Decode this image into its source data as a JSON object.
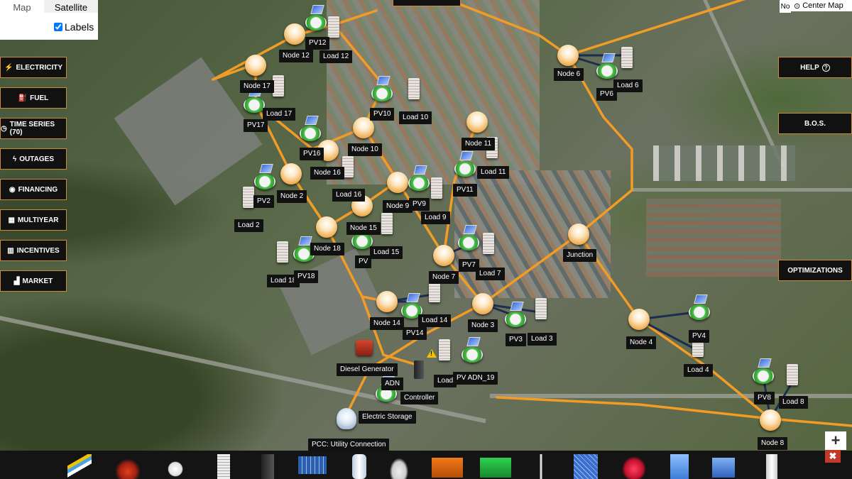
{
  "map_toggle": {
    "map_label": "Map",
    "satellite_label": "Satellite",
    "labels_label": "Labels",
    "labels_checked": true
  },
  "top_right": {
    "center_map_label": "Center Map",
    "no_label": "No"
  },
  "left_menu": [
    {
      "key": "electricity",
      "label": "ELECTRICITY",
      "icon": "bolt-icon",
      "glyph": "⚡"
    },
    {
      "key": "fuel",
      "label": "FUEL",
      "icon": "fuel-pump-icon",
      "glyph": "⛽"
    },
    {
      "key": "time-series",
      "label": "TIME SERIES (70)",
      "icon": "clock-icon",
      "glyph": "◷"
    },
    {
      "key": "outages",
      "label": "OUTAGES",
      "icon": "bolt-outline-icon",
      "glyph": "ϟ"
    },
    {
      "key": "financing",
      "label": "FINANCING",
      "icon": "globe-icon",
      "glyph": "◉"
    },
    {
      "key": "multiyear",
      "label": "MULTIYEAR",
      "icon": "calendar-icon",
      "glyph": "▦"
    },
    {
      "key": "incentives",
      "label": "INCENTIVES",
      "icon": "bar-chart-icon",
      "glyph": "▥"
    },
    {
      "key": "market",
      "label": "MARKET",
      "icon": "market-chart-icon",
      "glyph": "▟"
    }
  ],
  "right_menu": [
    {
      "key": "help",
      "label": "HELP",
      "icon": "question-circle-icon",
      "glyph": "?"
    },
    {
      "key": "bos",
      "label": "B.O.S.",
      "icon": "",
      "glyph": ""
    },
    {
      "key": "optimizations",
      "label": "OPTIMIZATIONS",
      "icon": "",
      "glyph": ""
    }
  ],
  "map_labels": [
    "Node 12",
    "Load 12",
    "PV12",
    "Node 6",
    "Load 6",
    "PV6",
    "Node 17",
    "Load 17",
    "PV17",
    "PV10",
    "Load 10",
    "Node 10",
    "PV16",
    "Node 16",
    "Node 11",
    "Load 11",
    "PV11",
    "PV2",
    "Node 2",
    "Load 2",
    "Load 16",
    "Node 9",
    "PV9",
    "Load 9",
    "Node 15",
    "Load 15",
    "Node 18",
    "PV",
    "Load 18",
    "PV18",
    "Junction",
    "Node 7",
    "PV7",
    "Load 7",
    "Node 14",
    "Load 14",
    "PV14",
    "Node 3",
    "PV3",
    "Load 3",
    "Node 4",
    "PV4",
    "Load 4",
    "Diesel Generator",
    "ADN",
    "Controller",
    "Load",
    "PV ADN_19",
    "Electric Storage",
    "PV8",
    "Load 8",
    "Node 8",
    "PCC: Utility Connection"
  ],
  "toolbar_items": [
    "cable-icon",
    "fence-icon",
    "transformer-icon",
    "building-load-icon",
    "battery-cabinet-icon",
    "solar-panel-icon",
    "storage-tank-icon",
    "electric-vehicle-icon",
    "orange-generator-icon",
    "green-generator-icon",
    "wind-turbine-icon",
    "solar-thermal-icon",
    "fuel-tank-icon",
    "blue-building-icon",
    "house-icon",
    "white-cabinet-icon"
  ],
  "controls": {
    "zoom_in": "+",
    "close": "✖"
  },
  "colors": {
    "line_orange": "#f29c26",
    "line_dark": "#1c2d52",
    "button_border": "#c98a3a",
    "toolbar_bg": "#141414"
  }
}
